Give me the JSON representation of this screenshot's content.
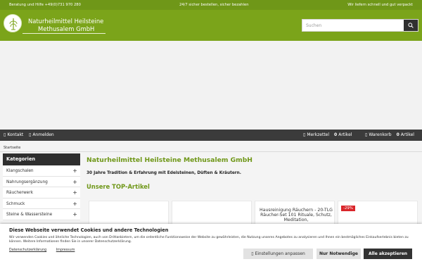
{
  "topbar": {
    "left": "Beratung und Hilfe +49(0)731 970 280",
    "center": "24/7 sicher bestellen, sicher bezahlen",
    "right": "Wir liefern schnell und gut verpackt"
  },
  "brand": {
    "line1": "Naturheilmittel Heilsteine",
    "line2": "Methusalem GmbH"
  },
  "search": {
    "placeholder": "Suchen"
  },
  "nav": {
    "contact": "Kontakt",
    "login": "Anmelden",
    "wishlist_label": "Merkzettel",
    "wishlist_count": "0",
    "wishlist_unit": "Artikel",
    "cart_label": "Warenkorb",
    "cart_count": "0",
    "cart_unit": "Artikel"
  },
  "breadcrumb": {
    "home": "Startseite"
  },
  "sidebar": {
    "title": "Kategorien",
    "items": [
      {
        "label": "Klangschalen"
      },
      {
        "label": "Nahrungsergänzung"
      },
      {
        "label": "Räucherwerk"
      },
      {
        "label": "Schmuck"
      },
      {
        "label": "Steine & Wassersteine"
      }
    ]
  },
  "main": {
    "title": "Naturheilmittel Heilsteine Methusalem GmbH",
    "subtitle": "30 Jahre Tradition & Erfahrung mit Edelsteinen, Düften & Kräutern.",
    "top_heading": "Unsere TOP-Artikel"
  },
  "products": [
    {
      "title": ""
    },
    {
      "title": ""
    },
    {
      "title": "Hausreinigung Räuchern - 20-TLG Räucher-Set 101 Rituale, Schutz, Meditation,"
    },
    {
      "title": "",
      "badge": "-29%"
    }
  ],
  "cookie": {
    "title": "Diese Webseite verwendet Cookies und andere Technologien",
    "text": "Wir verwenden Cookies und ähnliche Technologien, auch von Drittanbietern, um die ordentliche Funktionsweise der Website zu gewährleisten, die Nutzung unseres Angebotes zu analysieren und Ihnen ein bestmögliches Einkaufserlebnis bieten zu können. Weitere Informationen finden Sie in unserer Datenschutzerklärung.",
    "link_privacy": "Datenschutzerklärung",
    "link_imprint": "Impressum",
    "btn_settings": "Einstellungen anpassen",
    "btn_necessary": "Nur Notwendige",
    "btn_accept": "Alle akzeptieren"
  },
  "colors": {
    "brand_green": "#7ba41a",
    "dark": "#3b3b3b",
    "accent_text": "#6f9718",
    "sale_red": "#d9252a"
  },
  "icons": [
    "logo-tree-icon",
    "search-icon",
    "contact-icon",
    "user-icon",
    "heart-icon",
    "cart-icon",
    "plus-icon",
    "gear-icon"
  ]
}
